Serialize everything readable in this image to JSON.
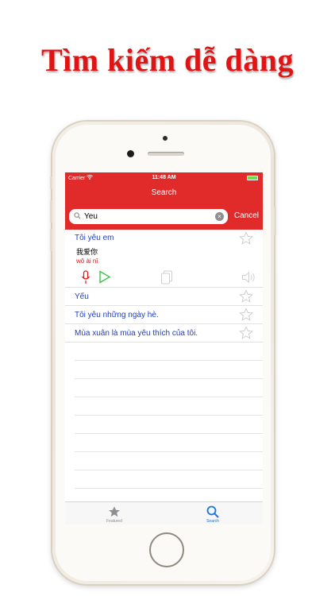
{
  "headline": "Tìm kiếm dễ dàng",
  "status": {
    "carrier": "Carrier",
    "time": "11:48 AM"
  },
  "nav": {
    "title": "Search"
  },
  "search": {
    "value": "Yeu",
    "cancel": "Cancel"
  },
  "results": [
    {
      "text": "Tôi yêu em",
      "chinese": "我爱你",
      "pinyin": "wǒ ài nǐ"
    },
    {
      "text": "Yếu"
    },
    {
      "text": "Tôi yêu những ngày hè."
    },
    {
      "text": "Mùa xuân là mùa yêu thích của tôi."
    }
  ],
  "tabs": [
    {
      "label": "Featured",
      "icon": "star-icon",
      "active": false
    },
    {
      "label": "Search",
      "icon": "search-icon",
      "active": true
    }
  ],
  "colors": {
    "accent": "#e12a2a",
    "link": "#1e3fbf",
    "pinyin": "#e01414",
    "active_tab": "#1a73e8",
    "inactive_tab": "#8e8e93"
  }
}
